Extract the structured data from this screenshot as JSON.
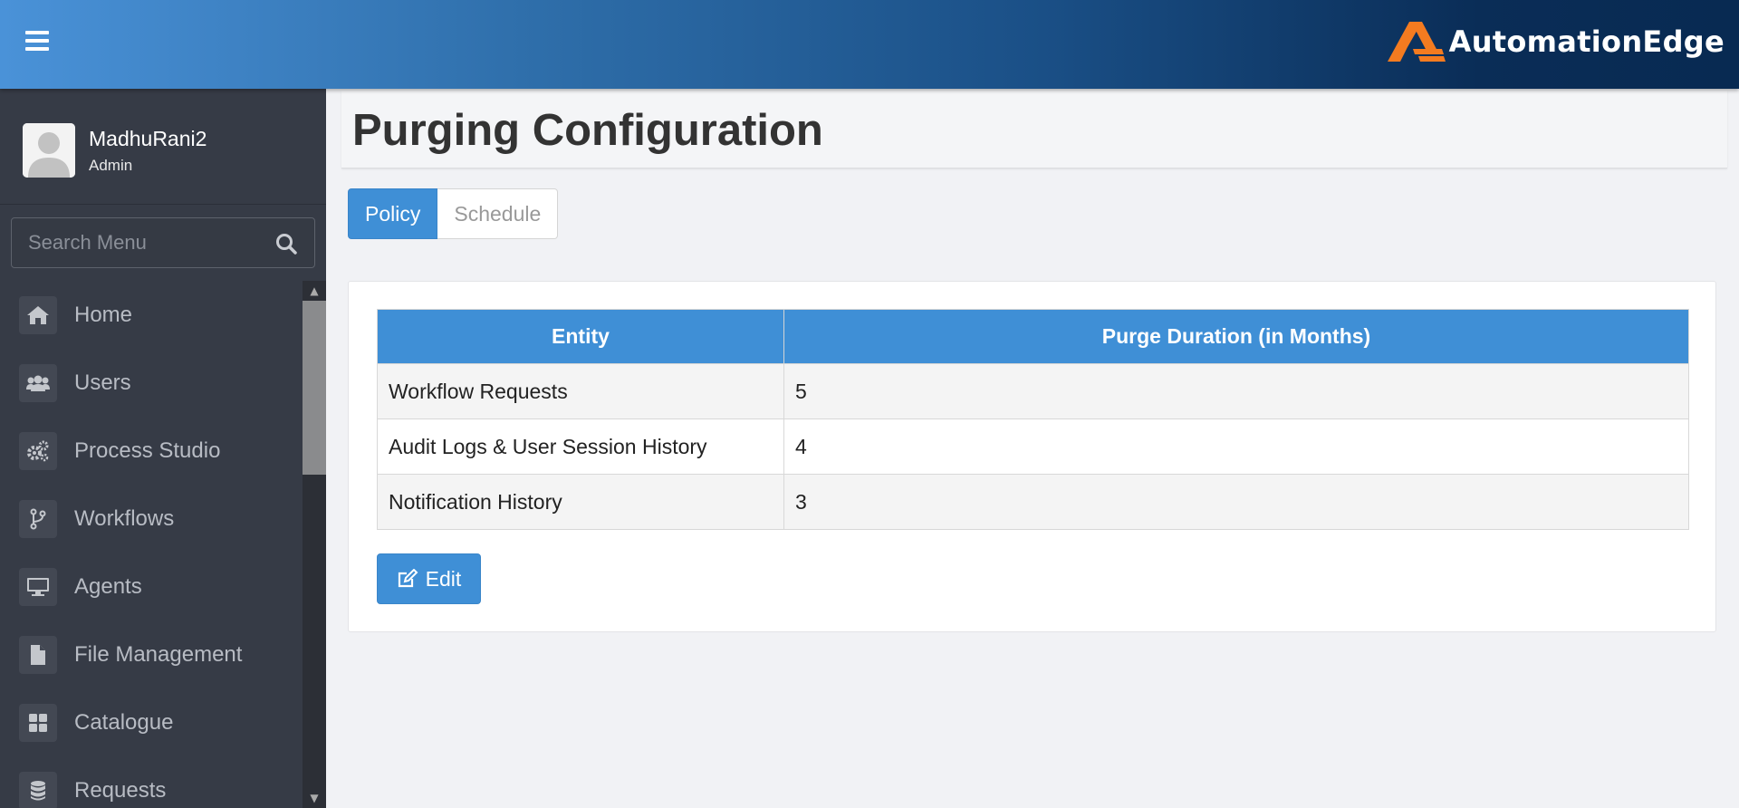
{
  "header": {
    "menu_icon": "hamburger-icon",
    "logo_text": "AutomationEdge",
    "logo_color": "#f47b20"
  },
  "user": {
    "name": "MadhuRani2",
    "role": "Admin"
  },
  "search": {
    "placeholder": "Search Menu",
    "icon": "search-icon"
  },
  "sidebar": {
    "items": [
      {
        "label": "Home",
        "icon": "home-icon"
      },
      {
        "label": "Users",
        "icon": "users-icon"
      },
      {
        "label": "Process Studio",
        "icon": "gears-icon"
      },
      {
        "label": "Workflows",
        "icon": "code-branch-icon"
      },
      {
        "label": "Agents",
        "icon": "desktop-icon"
      },
      {
        "label": "File Management",
        "icon": "file-icon"
      },
      {
        "label": "Catalogue",
        "icon": "grid-icon"
      },
      {
        "label": "Requests",
        "icon": "database-icon"
      }
    ]
  },
  "page": {
    "title": "Purging Configuration"
  },
  "tabs": [
    {
      "label": "Policy",
      "active": true
    },
    {
      "label": "Schedule",
      "active": false
    }
  ],
  "table": {
    "headers": [
      "Entity",
      "Purge Duration (in Months)"
    ],
    "rows": [
      [
        "Workflow Requests",
        "5"
      ],
      [
        "Audit Logs & User Session History",
        "4"
      ],
      [
        "Notification History",
        "3"
      ]
    ]
  },
  "edit_button": {
    "label": "Edit",
    "icon": "edit-icon"
  },
  "colors": {
    "accent": "#3f8fd6",
    "sidebar_bg": "#363b46"
  }
}
